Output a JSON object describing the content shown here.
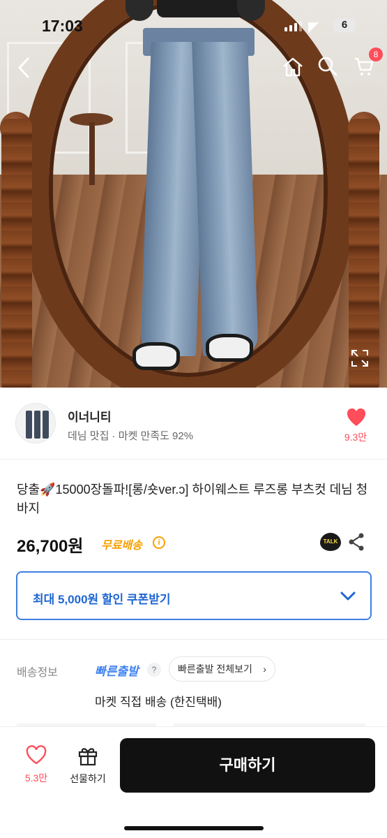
{
  "status_bar": {
    "time": "17:03",
    "battery": "6"
  },
  "nav": {
    "cart_count": "8"
  },
  "seller": {
    "name": "이너니티",
    "meta": "데님 맛집 · 마켓 만족도 92%",
    "likes": "9.3만"
  },
  "product": {
    "title": "당출🚀15000장돌파![롱/숏ver.ↄ] 하이웨스트 루즈롱 부츠컷 데님 청바지",
    "price": "26,700원",
    "free_shipping": "무료배송",
    "info_glyph": "i",
    "talk_label": "TALK"
  },
  "coupon": {
    "label": "최대 5,000원 할인 쿠폰받기"
  },
  "shipping": {
    "label": "배송정보",
    "fast": "빠른출발",
    "help_glyph": "?",
    "fast_view_all": "빠른출발 전체보기",
    "pill_chevron": "›",
    "detail": "마켓 직접 배송 (한진택배)"
  },
  "bottom_bar": {
    "likes": "5.3만",
    "gift_label": "선물하기",
    "buy_label": "구매하기"
  },
  "colors": {
    "accent_pink": "#ff4d5a",
    "coupon_blue": "#1f66d3",
    "free_ship_orange": "#f5a000",
    "buy_button": "#111111"
  },
  "icons": [
    "back-icon",
    "home-icon",
    "search-icon",
    "cart-icon",
    "expand-icon",
    "heart-icon",
    "info-icon",
    "kakao-talk-icon",
    "share-icon",
    "chevron-down-icon",
    "help-icon",
    "chevron-right-icon",
    "gift-icon"
  ]
}
